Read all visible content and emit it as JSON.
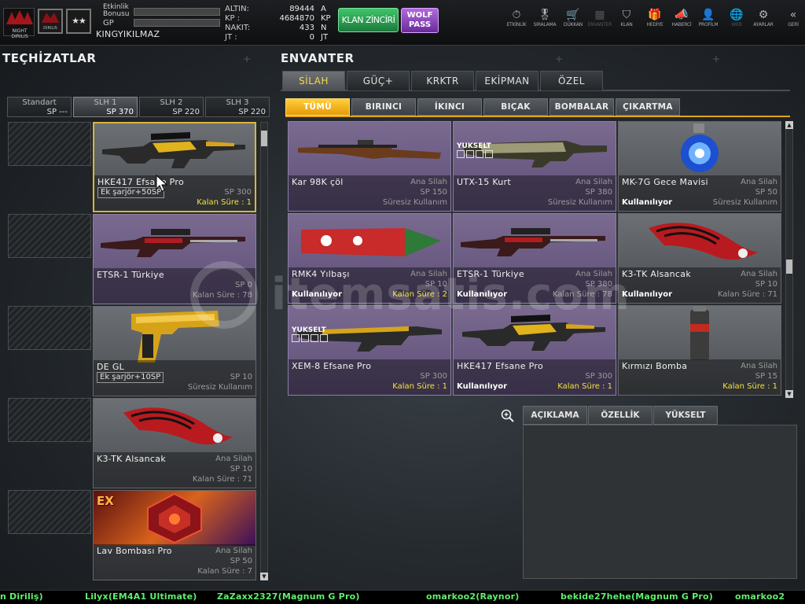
{
  "header": {
    "rank_text": "NIGHT DIRILIS",
    "emblem_text": "DIRILIS",
    "stars": "★★",
    "event_bonus_label": "Etkinlik Bonusu",
    "gp_label": "GP",
    "username": "KINGYIKILMAZ",
    "currencies": [
      {
        "label": "ALTIN:",
        "value": "89444",
        "unit": "A"
      },
      {
        "label": "KP   :",
        "value": "4684870",
        "unit": "KP"
      },
      {
        "label": "NAKIT:",
        "value": "433",
        "unit": "N"
      },
      {
        "label": "JT   :",
        "value": "0",
        "unit": "JT"
      }
    ],
    "klan_button": "KLAN ZİNCİRİ",
    "wolf_pass_line1": "WOLF",
    "wolf_pass_line2": "PASS",
    "nav": [
      {
        "label": "ETKİNLİK",
        "icon": "stopwatch-icon",
        "glyph": "⏱"
      },
      {
        "label": "SIRALAMA",
        "icon": "medal-icon",
        "glyph": "🎖"
      },
      {
        "label": "DÜKKAN",
        "icon": "cart-icon",
        "glyph": "🛒"
      },
      {
        "label": "ENVANTER",
        "icon": "inventory-icon",
        "glyph": "▦"
      },
      {
        "label": "KLAN",
        "icon": "shield-icon",
        "glyph": "⛉"
      },
      {
        "label": "HEDİYE",
        "icon": "gift-icon",
        "glyph": "🎁"
      },
      {
        "label": "HABERCİ",
        "icon": "megaphone-icon",
        "glyph": "📣"
      },
      {
        "label": "PROFİLM",
        "icon": "profile-icon",
        "glyph": "👤"
      },
      {
        "label": "WEB",
        "icon": "globe-icon",
        "glyph": "🌐"
      },
      {
        "label": "AYARLAR",
        "icon": "gear-icon",
        "glyph": "⚙"
      },
      {
        "label": "GERİ",
        "icon": "back-chevron-icon",
        "glyph": "«"
      }
    ]
  },
  "equipment": {
    "title": "TEÇHİZATLAR",
    "slots": [
      {
        "name": "Standart",
        "sp": "SP ---"
      },
      {
        "name": "SLH 1",
        "sp": "SP 370"
      },
      {
        "name": "SLH 2",
        "sp": "SP 220"
      },
      {
        "name": "SLH 3",
        "sp": "SP 220"
      }
    ],
    "items": [
      {
        "name": "HKE417 Efsane Pro",
        "extra": "Ek şarjör+50SP",
        "sp": "SP 300",
        "status": "Kalan Süre : 1"
      },
      {
        "name": "ETSR-1 Türkiye",
        "sp": "SP 0",
        "status": "Kalan Süre : 78"
      },
      {
        "name": "DE GL",
        "extra": "Ek şarjör+10SP",
        "sp": "SP 10",
        "status": "Süresiz Kullanım"
      },
      {
        "name": "K3-TK Alsancak",
        "type": "Ana Silah",
        "sp": "SP 10",
        "status": "Kalan Süre : 71"
      },
      {
        "name": "Lav Bombası Pro",
        "type": "Ana Silah",
        "sp": "SP 50",
        "status": "Kalan Süre : 7",
        "badge": "EX"
      }
    ]
  },
  "inventory": {
    "title": "ENVANTER",
    "tabs": [
      "SİLAH",
      "GÜÇ+",
      "KRKTR",
      "EKİPMAN",
      "ÖZEL"
    ],
    "subtabs": [
      "TÜMÜ",
      "BIRINCI",
      "İKINCI",
      "BIÇAK",
      "BOMBALAR",
      "ÇIKARTMA"
    ],
    "items": [
      {
        "name": "Kar 98K çöl",
        "type": "Ana Silah",
        "sp": "SP 150",
        "status": "Süresiz Kullanım",
        "in_use": ""
      },
      {
        "name": "UTX-15 Kurt",
        "type": "Ana Silah",
        "sp": "SP 380",
        "status": "Süresiz Kullanım",
        "in_use": "",
        "upgrade": "YUKSELT"
      },
      {
        "name": "MK-7G Gece Mavisi",
        "type": "Ana Silah",
        "sp": "SP 50",
        "status": "Süresiz Kullanım",
        "in_use": "Kullanılıyor"
      },
      {
        "name": "RMK4 Yılbaşı",
        "type": "Ana Silah",
        "sp": "SP 10",
        "status": "Kalan Süre : 2",
        "in_use": "Kullanılıyor"
      },
      {
        "name": "ETSR-1 Türkiye",
        "type": "Ana Silah",
        "sp": "SP 380",
        "status": "Kalan Süre : 78",
        "in_use": "Kullanılıyor"
      },
      {
        "name": "K3-TK Alsancak",
        "type": "Ana Silah",
        "sp": "SP 10",
        "status": "Kalan Süre : 71",
        "in_use": "Kullanılıyor"
      },
      {
        "name": "XEM-8 Efsane Pro",
        "type": "",
        "sp": "SP 300",
        "status": "Kalan Süre : 1",
        "in_use": "",
        "upgrade": "YUKSELT"
      },
      {
        "name": "HKE417 Efsane Pro",
        "type": "",
        "sp": "SP 300",
        "status": "Kalan Süre : 1",
        "in_use": "Kullanılıyor"
      },
      {
        "name": "Kırmızı Bomba",
        "type": "Ana Silah",
        "sp": "SP 15",
        "status": "Kalan Süre : 1",
        "in_use": ""
      }
    ],
    "detail_tabs": [
      "AÇIKLAMA",
      "ÖZELLİK",
      "YÜKSELT"
    ]
  },
  "ticker": [
    "n Diriliş)",
    "Lilyx(EM4A1 Ultimate)",
    "ZaZaxx2327(Magnum G Pro)",
    "omarkoo2(Raynor)",
    "bekide27hehe(Magnum G Pro)",
    "omarkoo2"
  ],
  "watermark": "itemsatis.com",
  "colors": {
    "accent": "#f4e23a",
    "klan": "#2da152",
    "wolf": "#9446c4",
    "ticker": "#5ef06a"
  }
}
